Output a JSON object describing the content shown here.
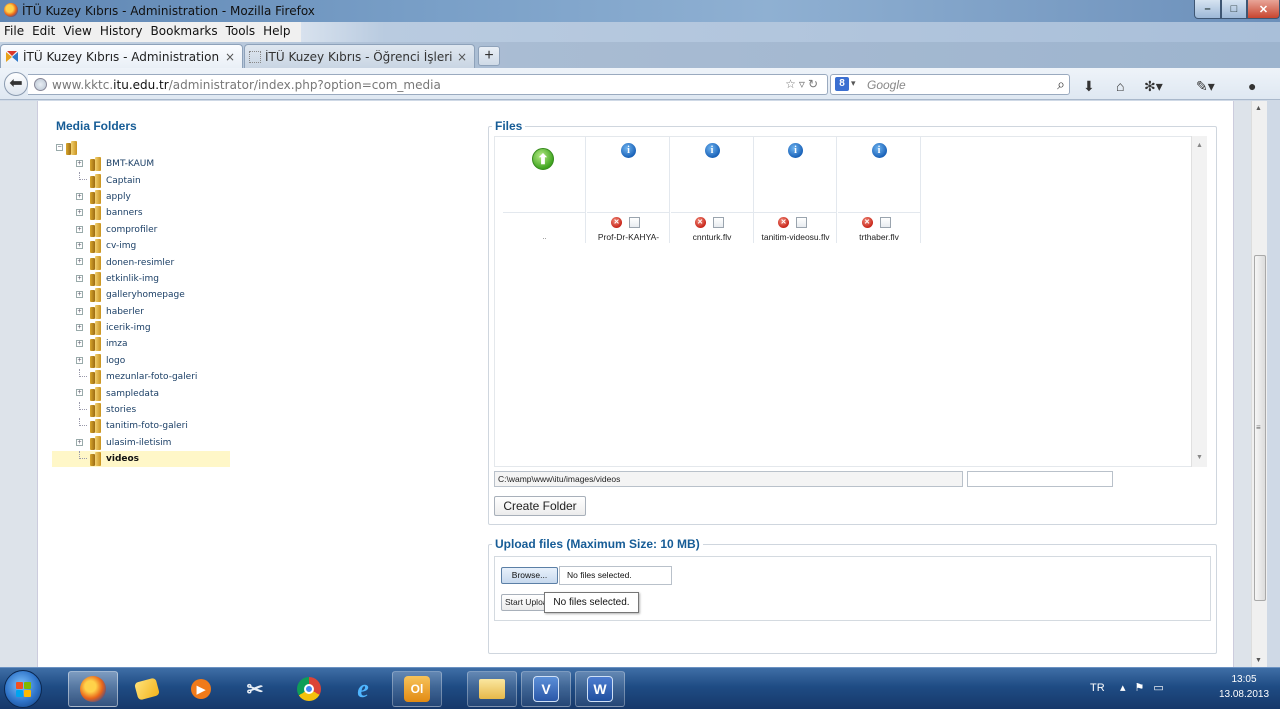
{
  "window": {
    "title": "İTÜ Kuzey Kıbrıs - Administration - Mozilla Firefox",
    "minimize": "–",
    "maximize": "□",
    "close": "✕"
  },
  "menubar": [
    "File",
    "Edit",
    "View",
    "History",
    "Bookmarks",
    "Tools",
    "Help"
  ],
  "tabs": [
    {
      "label": "İTÜ Kuzey Kıbrıs - Administration",
      "active": true
    },
    {
      "label": "İTÜ Kuzey Kıbrıs - Öğrenci İşleri Müd...",
      "active": false
    }
  ],
  "tab_close": "×",
  "new_tab": "+",
  "navbar": {
    "url_prefix": "www.kktc.",
    "url_domain": "itu.edu.tr",
    "url_path": "/administrator/index.php?option=com_media",
    "search_engine": "8",
    "search_placeholder": "Google"
  },
  "media_folders": {
    "title": "Media Folders",
    "folders": [
      {
        "name": "BMT-KAUM",
        "expandable": true
      },
      {
        "name": "Captain",
        "expandable": false
      },
      {
        "name": "apply",
        "expandable": true
      },
      {
        "name": "banners",
        "expandable": true
      },
      {
        "name": "comprofiler",
        "expandable": true
      },
      {
        "name": "cv-img",
        "expandable": true
      },
      {
        "name": "donen-resimler",
        "expandable": true
      },
      {
        "name": "etkinlik-img",
        "expandable": true
      },
      {
        "name": "galleryhomepage",
        "expandable": true
      },
      {
        "name": "haberler",
        "expandable": true
      },
      {
        "name": "icerik-img",
        "expandable": true
      },
      {
        "name": "imza",
        "expandable": true
      },
      {
        "name": "logo",
        "expandable": true
      },
      {
        "name": "mezunlar-foto-galeri",
        "expandable": false
      },
      {
        "name": "sampledata",
        "expandable": true
      },
      {
        "name": "stories",
        "expandable": false
      },
      {
        "name": "tanitim-foto-galeri",
        "expandable": false
      },
      {
        "name": "ulasim-iletisim",
        "expandable": true
      },
      {
        "name": "videos",
        "expandable": false,
        "selected": true
      }
    ]
  },
  "files": {
    "title": "Files",
    "parent_label": "..",
    "items": [
      {
        "name": "Prof-Dr-KAHYA-"
      },
      {
        "name": "cnnturk.flv"
      },
      {
        "name": "tanitim-videosu.flv"
      },
      {
        "name": "trthaber.flv"
      }
    ],
    "path": "C:\\wamp\\www\\itu/images/videos",
    "create_folder_label": "Create Folder"
  },
  "upload": {
    "title": "Upload files (Maximum Size: 10 MB)",
    "browse_label": "Browse...",
    "file_status": "No files selected.",
    "start_upload_label": "Start Upload",
    "tooltip": "No files selected."
  },
  "taskbar": {
    "apps": [
      "start",
      "firefox",
      "explorer-folders",
      "media-player",
      "snipping-tool",
      "chrome",
      "internet-explorer",
      "outlook",
      "file-explorer",
      "visio",
      "word"
    ],
    "language": "TR",
    "time": "13:05",
    "date": "13.08.2013"
  }
}
